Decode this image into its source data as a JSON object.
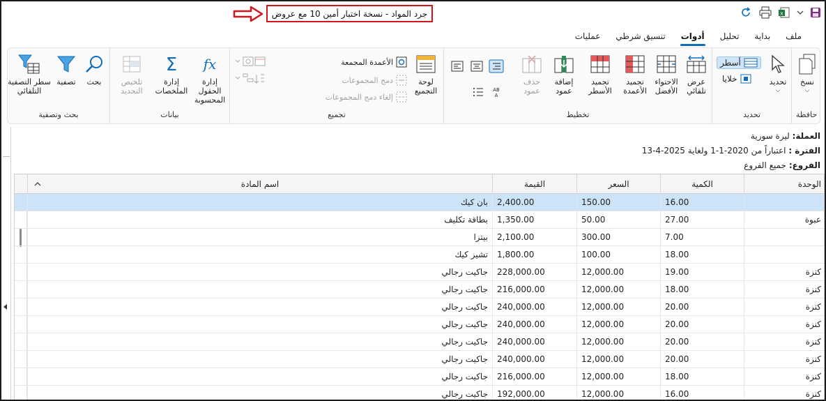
{
  "window": {
    "title": "جرد المواد - نسخة اختبار أمين 10 مع عروض"
  },
  "quick_access": [
    "save-icon",
    "dropdown-icon",
    "excel-icon",
    "print-icon",
    "refresh-icon"
  ],
  "tabs": [
    {
      "label": "ملف",
      "active": false
    },
    {
      "label": "بداية",
      "active": false
    },
    {
      "label": "تحليل",
      "active": false
    },
    {
      "label": "أدوات",
      "active": true
    },
    {
      "label": "تنسيق شرطي",
      "active": false
    },
    {
      "label": "عمليات",
      "active": false
    }
  ],
  "ribbon": {
    "clipboard": {
      "label": "حافظة",
      "copy": "نسخ"
    },
    "selection": {
      "label": "تحديد",
      "select": "تحديد",
      "rows": "أسطر",
      "cells": "خلايا"
    },
    "layout": {
      "label": "تخطيط",
      "auto_fit": "عرض تلقائي",
      "best_fit": "الاحتواء الأفضل",
      "freeze_cols": "تجميد الأعمدة",
      "freeze_rows": "تجميد الأسطر",
      "add_col": "إضافة عمود",
      "del_col": "حذف عمود"
    },
    "grouping": {
      "label": "تجميع",
      "group_panel": "لوحة التجميع",
      "grouped_cols": "الأعمدة المجمعة",
      "merge_groups": "دمج المجموعات",
      "unmerge_groups": "إلغاء دمج المجموعات"
    },
    "data": {
      "label": "بيانات",
      "calc_fields": "إدارة الحقول المحسوبة",
      "summaries": "إدارة الملخصات",
      "summarize_sel": "تلخيص التحديد"
    },
    "search": {
      "label": "بحث وتصفية",
      "search": "بحث",
      "filter": "تصفية",
      "auto_filter_row": "سطر التصفية التلقائي"
    }
  },
  "info": {
    "currency_label": "العملة:",
    "currency_value": "ليرة سورية",
    "period_label": "الفترة :",
    "period_value": "اعتباراً من 2020-1-1 ولغاية 2025-4-13",
    "branches_label": "الفروع:",
    "branches_value": "جميع الفروع"
  },
  "grid": {
    "columns": {
      "unit": "الوحدة",
      "qty": "الكمية",
      "price": "السعر",
      "value": "القيمة",
      "name": "اسم المادة"
    },
    "rows": [
      {
        "unit": "",
        "qty": "16.00",
        "price": "150.00",
        "value": "2,400.00",
        "name": "بان كيك"
      },
      {
        "unit": "عبوة",
        "qty": "27.00",
        "price": "50.00",
        "value": "1,350.00",
        "name": "بطاقة تكليف"
      },
      {
        "unit": "",
        "qty": "7.00",
        "price": "300.00",
        "value": "2,100.00",
        "name": "بيتزا"
      },
      {
        "unit": "",
        "qty": "18.00",
        "price": "100.00",
        "value": "1,800.00",
        "name": "تشيز كيك"
      },
      {
        "unit": "كنزة",
        "qty": "19.00",
        "price": "12,000.00",
        "value": "228,000.00",
        "name": "جاكيت رجالي"
      },
      {
        "unit": "كنزة",
        "qty": "18.00",
        "price": "12,000.00",
        "value": "216,000.00",
        "name": "جاكيت رجالي"
      },
      {
        "unit": "كنزة",
        "qty": "20.00",
        "price": "12,000.00",
        "value": "240,000.00",
        "name": "جاكيت رجالي"
      },
      {
        "unit": "كنزة",
        "qty": "20.00",
        "price": "12,000.00",
        "value": "240,000.00",
        "name": "جاكيت رجالي"
      },
      {
        "unit": "كنزة",
        "qty": "20.00",
        "price": "12,000.00",
        "value": "240,000.00",
        "name": "جاكيت رجالي"
      },
      {
        "unit": "كنزة",
        "qty": "20.00",
        "price": "12,000.00",
        "value": "240,000.00",
        "name": "جاكيت رجالي"
      },
      {
        "unit": "كنزة",
        "qty": "18.00",
        "price": "12,000.00",
        "value": "216,000.00",
        "name": "جاكيت رجالي"
      },
      {
        "unit": "كنزة",
        "qty": "16.00",
        "price": "12,000.00",
        "value": "192,000.00",
        "name": "جاكيت رجالي"
      }
    ]
  },
  "colors": {
    "accent": "#0f6cbd",
    "highlight_red": "#d4141c",
    "selected_row": "#cde3f8"
  }
}
